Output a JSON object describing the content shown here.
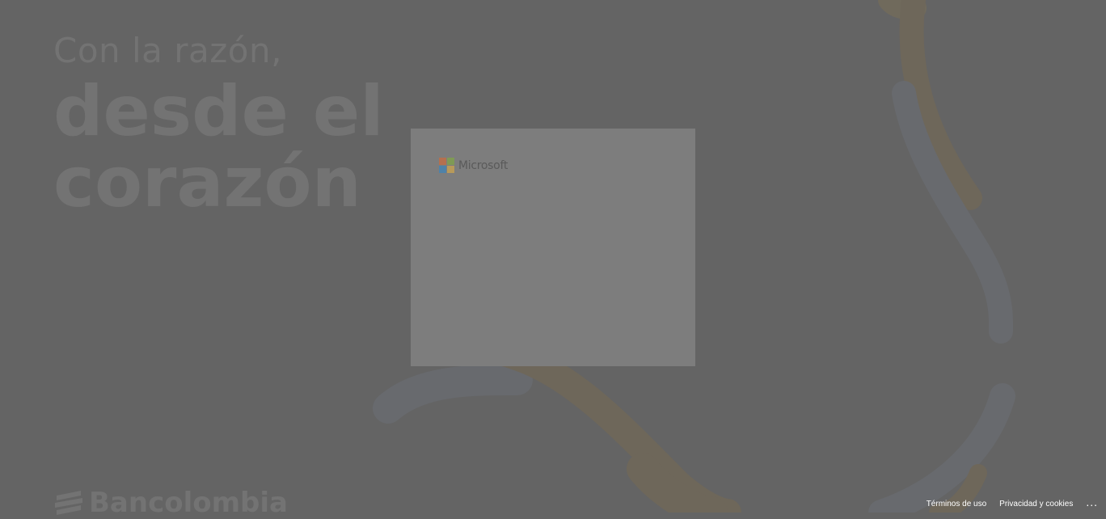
{
  "background": {
    "tagline_line1": "Con la razón,",
    "tagline_line2": "desde el",
    "tagline_line3": "corazón",
    "brand_name": "Bancolombia"
  },
  "card": {
    "logo_text": "Microsoft",
    "logo_colors": [
      "#c55a3a",
      "#7a9a3a",
      "#3a7ab0",
      "#c8a24a"
    ]
  },
  "footer": {
    "terms": "Términos de uso",
    "privacy": "Privacidad y cookies",
    "more": "..."
  },
  "colors": {
    "overlay": "#646464",
    "card": "#7d7d7d"
  }
}
